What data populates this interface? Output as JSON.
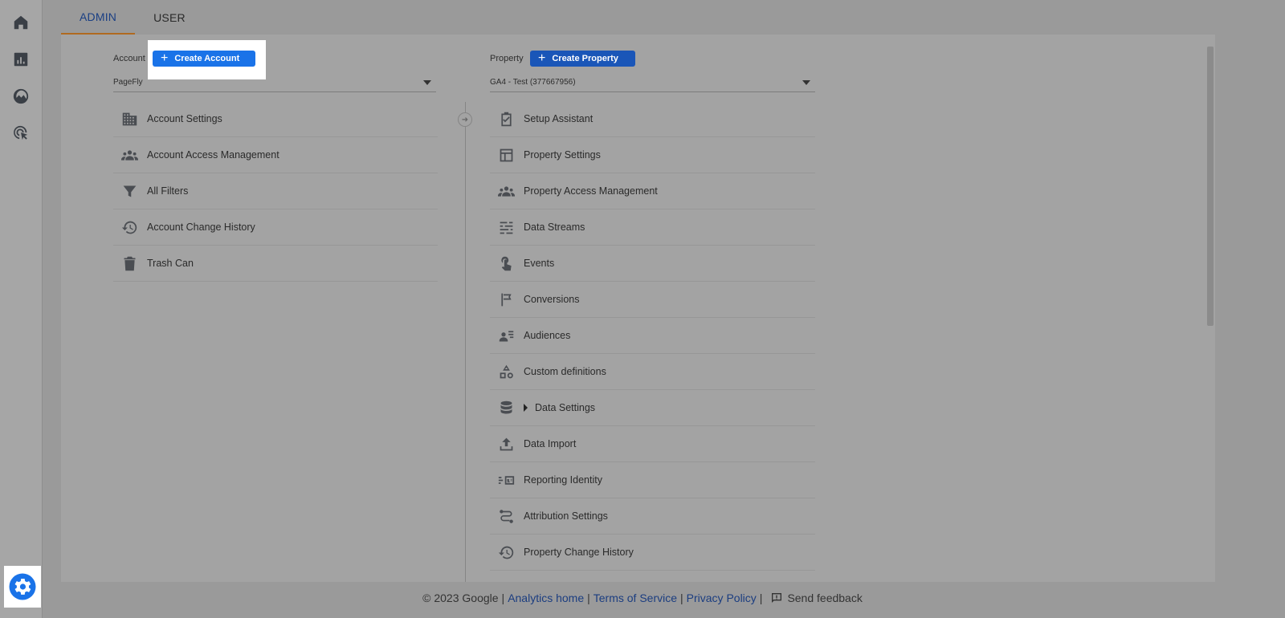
{
  "tabs": [
    {
      "label": "ADMIN",
      "active": true
    },
    {
      "label": "USER",
      "active": false
    }
  ],
  "rail": {
    "items": [
      "home-icon",
      "reports-icon",
      "explore-icon",
      "advertising-icon"
    ],
    "settings": "settings-icon"
  },
  "account": {
    "label": "Account",
    "create_button": "Create Account",
    "selected": "PageFly",
    "items": [
      {
        "label": "Account Settings",
        "icon": "building-icon"
      },
      {
        "label": "Account Access Management",
        "icon": "people-icon"
      },
      {
        "label": "All Filters",
        "icon": "filter-icon"
      },
      {
        "label": "Account Change History",
        "icon": "history-icon"
      },
      {
        "label": "Trash Can",
        "icon": "trash-icon"
      }
    ]
  },
  "property": {
    "label": "Property",
    "create_button": "Create Property",
    "selected": "GA4 - Test (377667956)",
    "items": [
      {
        "label": "Setup Assistant",
        "icon": "checkbox-icon"
      },
      {
        "label": "Property Settings",
        "icon": "layout-icon"
      },
      {
        "label": "Property Access Management",
        "icon": "people-icon"
      },
      {
        "label": "Data Streams",
        "icon": "streams-icon"
      },
      {
        "label": "Events",
        "icon": "touch-icon"
      },
      {
        "label": "Conversions",
        "icon": "flag-icon"
      },
      {
        "label": "Audiences",
        "icon": "audience-icon"
      },
      {
        "label": "Custom definitions",
        "icon": "shapes-icon"
      },
      {
        "label": "Data Settings",
        "icon": "database-icon"
      },
      {
        "label": "Data Import",
        "icon": "upload-icon"
      },
      {
        "label": "Reporting Identity",
        "icon": "identity-icon"
      },
      {
        "label": "Attribution Settings",
        "icon": "route-icon"
      },
      {
        "label": "Property Change History",
        "icon": "history-icon"
      }
    ]
  },
  "colors": {
    "accent_blue": "#1a73e8",
    "tab_underline": "#b06a20"
  },
  "footer": {
    "copyright": "© 2023 Google",
    "analytics_home": "Analytics home",
    "terms": "Terms of Service",
    "privacy": "Privacy Policy",
    "feedback": "Send feedback",
    "separator": "|"
  }
}
